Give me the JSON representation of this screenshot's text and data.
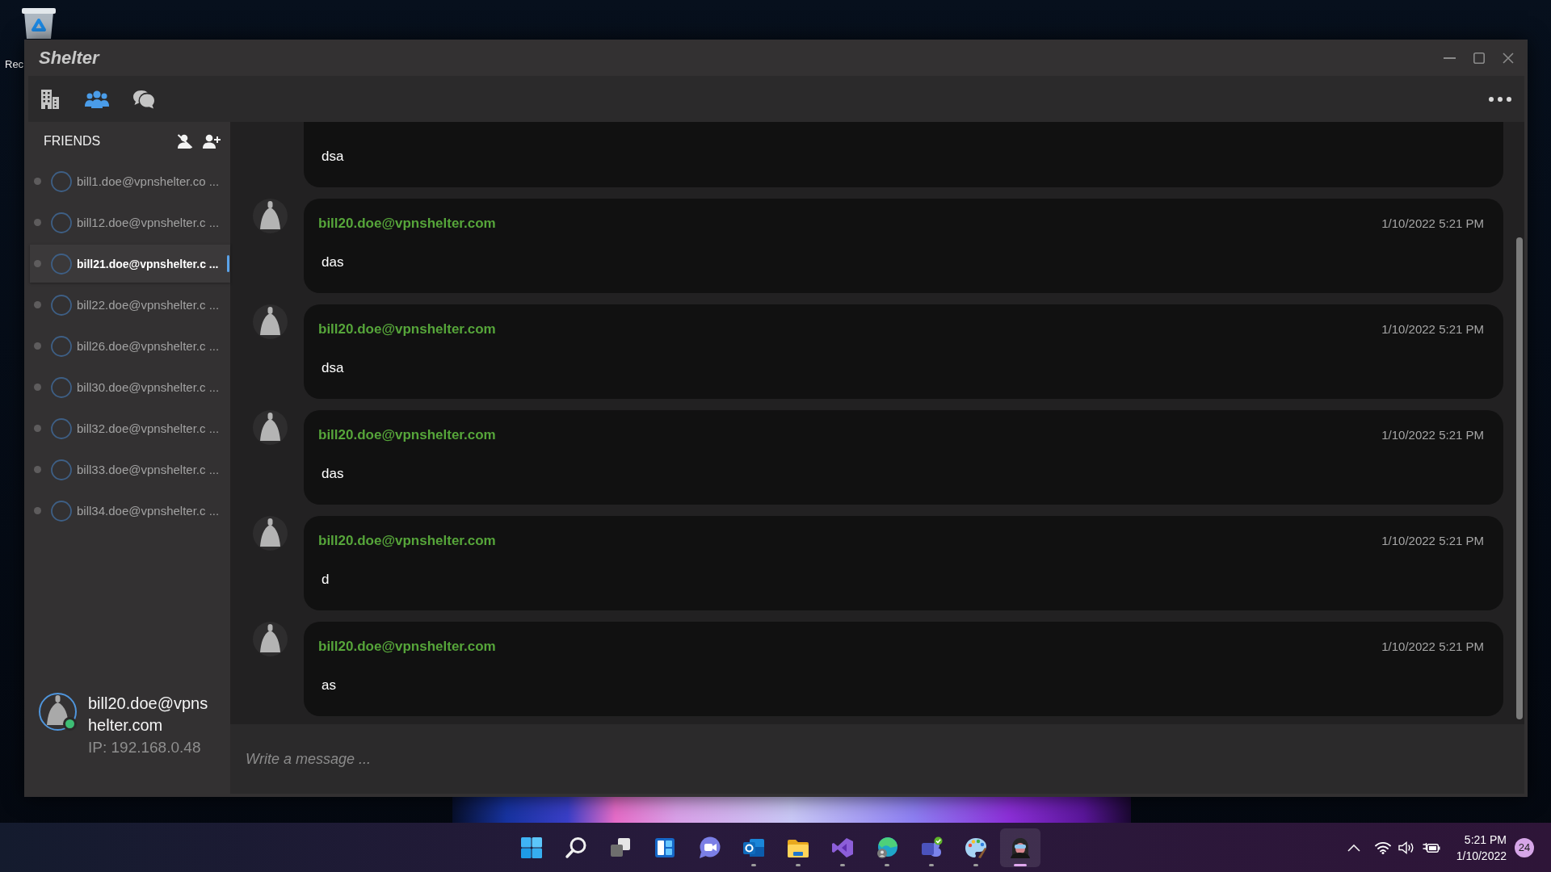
{
  "desktop": {
    "icons": [
      {
        "label": "Rec"
      }
    ]
  },
  "window": {
    "title": "Shelter"
  },
  "toolbar": {
    "tabs": [
      {
        "selected": false
      },
      {
        "selected": true
      },
      {
        "selected": false
      }
    ]
  },
  "sidebar": {
    "title": "FRIENDS",
    "friends": [
      {
        "name": "bill1.doe@vpnshelter.co ...",
        "online": false,
        "selected": false
      },
      {
        "name": "bill12.doe@vpnshelter.c ...",
        "online": false,
        "selected": false
      },
      {
        "name": "bill21.doe@vpnshelter.c ...",
        "online": false,
        "selected": true
      },
      {
        "name": "bill22.doe@vpnshelter.c ...",
        "online": false,
        "selected": false
      },
      {
        "name": "bill26.doe@vpnshelter.c ...",
        "online": false,
        "selected": false
      },
      {
        "name": "bill30.doe@vpnshelter.c ...",
        "online": false,
        "selected": false
      },
      {
        "name": "bill32.doe@vpnshelter.c ...",
        "online": false,
        "selected": false
      },
      {
        "name": "bill33.doe@vpnshelter.c ...",
        "online": false,
        "selected": false
      },
      {
        "name": "bill34.doe@vpnshelter.c ...",
        "online": false,
        "selected": false
      }
    ],
    "current_user": {
      "name": "bill20.doe@vpnshelter.com",
      "ip": "IP: 192.168.0.48",
      "online": true
    }
  },
  "chat": {
    "messages": [
      {
        "text": "dsa"
      },
      {
        "sender": "bill20.doe@vpnshelter.com",
        "time": "1/10/2022 5:21 PM",
        "text": "das"
      },
      {
        "sender": "bill20.doe@vpnshelter.com",
        "time": "1/10/2022 5:21 PM",
        "text": "dsa"
      },
      {
        "sender": "bill20.doe@vpnshelter.com",
        "time": "1/10/2022 5:21 PM",
        "text": "das"
      },
      {
        "sender": "bill20.doe@vpnshelter.com",
        "time": "1/10/2022 5:21 PM",
        "text": "d"
      },
      {
        "sender": "bill20.doe@vpnshelter.com",
        "time": "1/10/2022 5:21 PM",
        "text": "as"
      }
    ],
    "input": {
      "placeholder": "Write a message ..."
    }
  },
  "taskbar": {
    "apps": [
      {
        "running": false,
        "active": false
      },
      {
        "running": false,
        "active": false
      },
      {
        "running": false,
        "active": false
      },
      {
        "running": false,
        "active": false
      },
      {
        "running": false,
        "active": false
      },
      {
        "running": true,
        "active": false
      },
      {
        "running": true,
        "active": false
      },
      {
        "running": true,
        "active": false
      },
      {
        "running": true,
        "active": false
      },
      {
        "running": true,
        "active": false
      },
      {
        "running": true,
        "active": false
      },
      {
        "running": true,
        "active": true
      }
    ],
    "tray": {
      "time": "5:21 PM",
      "date": "1/10/2022",
      "notifications": "24"
    }
  }
}
